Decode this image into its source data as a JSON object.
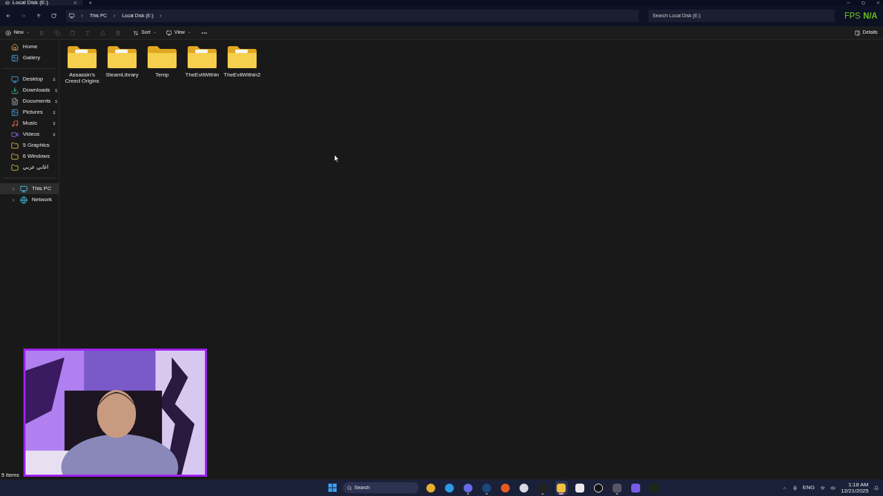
{
  "tab": {
    "title": "Local Disk (E:)"
  },
  "breadcrumb": [
    "This PC",
    "Local Disk (E:)"
  ],
  "search": {
    "placeholder": "Search Local Disk (E:)"
  },
  "overlay": {
    "label": "FPS",
    "value": "N/A"
  },
  "toolbar": {
    "new": "New",
    "sort": "Sort",
    "view": "View",
    "details": "Details"
  },
  "sidebar": {
    "top": [
      {
        "label": "Home",
        "selected": false
      },
      {
        "label": "Gallery",
        "selected": false
      }
    ],
    "quick": [
      {
        "label": "Desktop",
        "pinned": true
      },
      {
        "label": "Downloads",
        "pinned": true
      },
      {
        "label": "Documents",
        "pinned": true
      },
      {
        "label": "Pictures",
        "pinned": true
      },
      {
        "label": "Music",
        "pinned": true
      },
      {
        "label": "Videos",
        "pinned": true
      },
      {
        "label": "5 Graphics",
        "pinned": false
      },
      {
        "label": "6 Windows",
        "pinned": false
      },
      {
        "label": "اغاني عربي",
        "pinned": false
      }
    ],
    "drives": [
      {
        "label": "This PC",
        "selected": true,
        "expanded": false
      },
      {
        "label": "Network",
        "selected": false,
        "expanded": false
      }
    ]
  },
  "folders": [
    {
      "name": "Assassin's Creed Origins",
      "kind": "files"
    },
    {
      "name": "SteamLibrary",
      "kind": "files"
    },
    {
      "name": "Temp",
      "kind": "empty"
    },
    {
      "name": "TheEvilWithin",
      "kind": "files"
    },
    {
      "name": "TheEvilWithin2",
      "kind": "files"
    }
  ],
  "status_bar": {
    "count": "5 items"
  },
  "taskbar": {
    "search": "Search",
    "apps": [
      {
        "running": false,
        "selected": false
      },
      {
        "running": false,
        "selected": false
      },
      {
        "running": true,
        "selected": false
      },
      {
        "running": true,
        "selected": false
      },
      {
        "running": false,
        "selected": false
      },
      {
        "running": false,
        "selected": false
      },
      {
        "running": true,
        "selected": false
      },
      {
        "running": true,
        "selected": true
      },
      {
        "running": false,
        "selected": false
      },
      {
        "running": false,
        "selected": false
      },
      {
        "running": true,
        "selected": false
      },
      {
        "running": false,
        "selected": false
      },
      {
        "running": false,
        "selected": false
      }
    ],
    "language": "ENG",
    "time": "1:18 AM",
    "date": "12/21/2025"
  }
}
